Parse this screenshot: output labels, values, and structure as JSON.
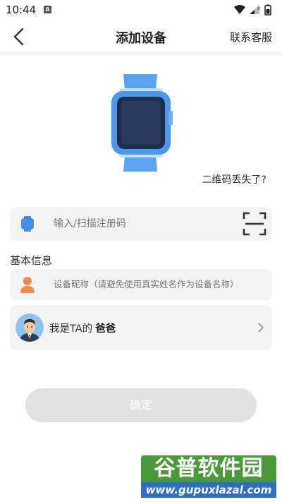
{
  "status_bar": {
    "time": "10:44",
    "notification_glyph": "A"
  },
  "nav": {
    "title": "添加设备",
    "action": "联系客服"
  },
  "qr_lost": "二维码丢失了?",
  "register": {
    "placeholder": "输入/扫描注册码"
  },
  "section": {
    "basic_info": "基本信息"
  },
  "nickname": {
    "placeholder": "设备昵称（请避免使用真实姓名作为设备名称）"
  },
  "role": {
    "prefix": "我是TA的",
    "value": "爸爸"
  },
  "confirm_label": "确定",
  "watermark": {
    "top": "谷普软件园",
    "bottom": "www.gupuxlazal.com"
  },
  "colors": {
    "accent_blue": "#3f8ee8",
    "orange": "#f5894a",
    "button_disabled": "#e1e1e1",
    "card_bg": "#f3f3f3"
  }
}
